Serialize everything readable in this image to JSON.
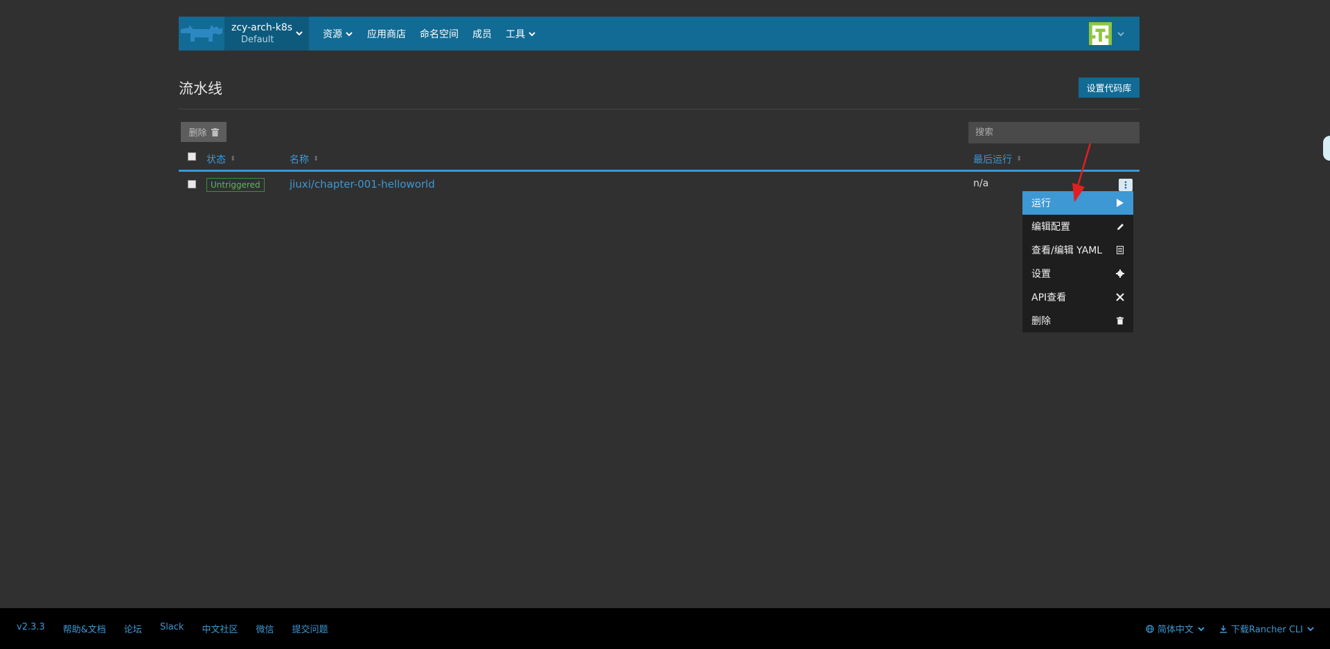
{
  "header": {
    "cluster_name": "zcy-arch-k8s",
    "project_name": "Default",
    "nav": [
      {
        "label": "资源",
        "dropdown": true
      },
      {
        "label": "应用商店",
        "dropdown": false
      },
      {
        "label": "命名空间",
        "dropdown": false
      },
      {
        "label": "成员",
        "dropdown": false
      },
      {
        "label": "工具",
        "dropdown": true
      }
    ]
  },
  "page": {
    "title": "流水线",
    "setup_repo_button": "设置代码库"
  },
  "toolbar": {
    "delete_label": "删除",
    "search_placeholder": "搜索"
  },
  "table": {
    "headers": {
      "state": "状态",
      "name": "名称",
      "last_run": "最后运行"
    },
    "rows": [
      {
        "state": "Untriggered",
        "name": "jiuxi/chapter-001-helloworld",
        "last_run": "n/a"
      }
    ]
  },
  "action_menu": {
    "items": [
      {
        "label": "运行",
        "icon": "play-icon",
        "active": true
      },
      {
        "label": "编辑配置",
        "icon": "pencil-icon",
        "active": false
      },
      {
        "label": "查看/编辑 YAML",
        "icon": "file-icon",
        "active": false
      },
      {
        "label": "设置",
        "icon": "gear-icon",
        "active": false
      },
      {
        "label": "API查看",
        "icon": "tools-icon",
        "active": false
      },
      {
        "label": "删除",
        "icon": "trash-icon",
        "active": false
      }
    ]
  },
  "footer": {
    "version": "v2.3.3",
    "links": [
      "帮助&文档",
      "论坛",
      "Slack",
      "中文社区",
      "微信",
      "提交问题"
    ],
    "language": "简体中文",
    "download_cli": "下载Rancher CLI"
  },
  "colors": {
    "brand": "#116b94",
    "accent": "#3d98d3",
    "background": "#303030",
    "success": "#5cb85c",
    "annotation": "#e02020"
  }
}
